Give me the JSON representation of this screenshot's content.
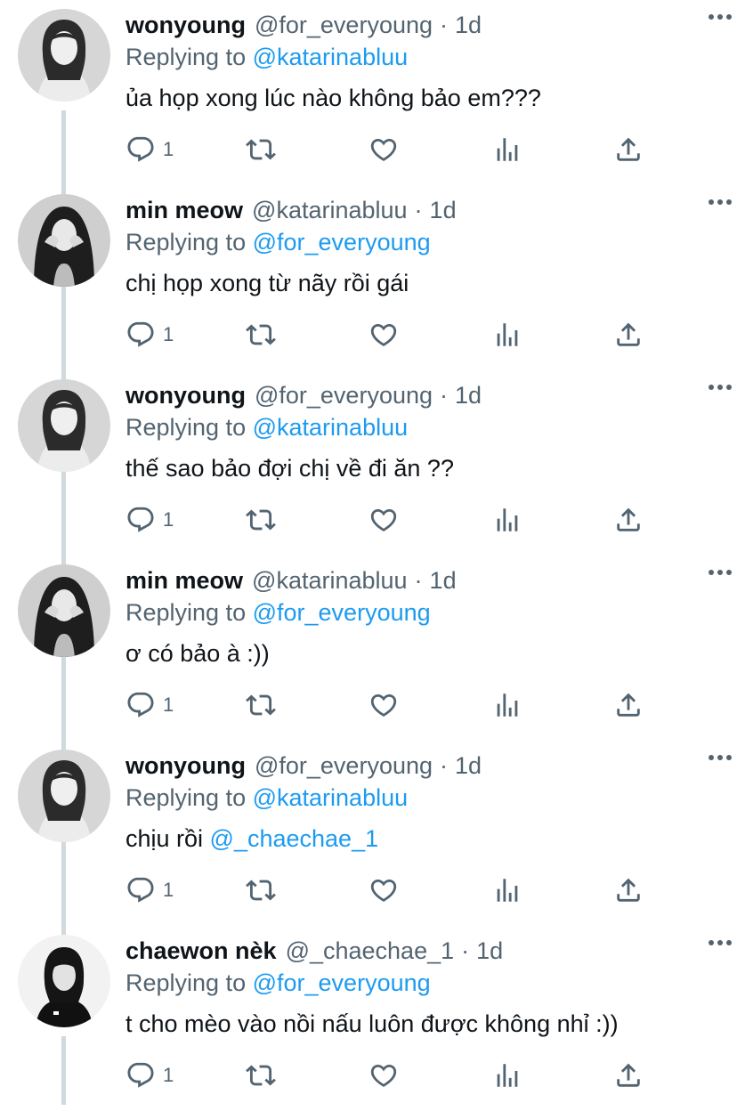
{
  "tweets": [
    {
      "name": "wonyoung",
      "handle": "@for_everyoung",
      "separator": "·",
      "time": "1d",
      "replying_prefix": "Replying to",
      "replying_to": "@katarinabluu",
      "text": "ủa họp xong lúc nào không bảo em???",
      "reply_count": "1",
      "avatar": "wonyoung-avatar"
    },
    {
      "name": "min meow",
      "handle": "@katarinabluu",
      "separator": "·",
      "time": "1d",
      "replying_prefix": "Replying to",
      "replying_to": "@for_everyoung",
      "text": "chị họp xong từ nãy rồi gái",
      "reply_count": "1",
      "avatar": "min-meow-avatar"
    },
    {
      "name": "wonyoung",
      "handle": "@for_everyoung",
      "separator": "·",
      "time": "1d",
      "replying_prefix": "Replying to",
      "replying_to": "@katarinabluu",
      "text": "thế sao bảo đợi chị về đi ăn ??",
      "reply_count": "1",
      "avatar": "wonyoung-avatar"
    },
    {
      "name": "min meow",
      "handle": "@katarinabluu",
      "separator": "·",
      "time": "1d",
      "replying_prefix": "Replying to",
      "replying_to": "@for_everyoung",
      "text": "ơ có bảo à :))",
      "reply_count": "1",
      "avatar": "min-meow-avatar"
    },
    {
      "name": "wonyoung",
      "handle": "@for_everyoung",
      "separator": "·",
      "time": "1d",
      "replying_prefix": "Replying to",
      "replying_to": "@katarinabluu",
      "text_prefix": "chịu rồi ",
      "text_mention": "@_chaechae_1",
      "reply_count": "1",
      "avatar": "wonyoung-avatar"
    },
    {
      "name": "chaewon nèk",
      "handle": "@_chaechae_1",
      "separator": "·",
      "time": "1d",
      "replying_prefix": "Replying to",
      "replying_to": "@for_everyoung",
      "text": "t cho mèo vào nồi nấu luôn được không nhỉ :))",
      "reply_count": "1",
      "avatar": "chaewon-avatar"
    }
  ],
  "colors": {
    "text": "#0f1419",
    "secondary": "#536471",
    "link": "#1d9bf0",
    "thread_line": "#cfd9de"
  },
  "icons": [
    "reply-icon",
    "retweet-icon",
    "like-icon",
    "stats-icon",
    "share-icon",
    "more-icon"
  ]
}
